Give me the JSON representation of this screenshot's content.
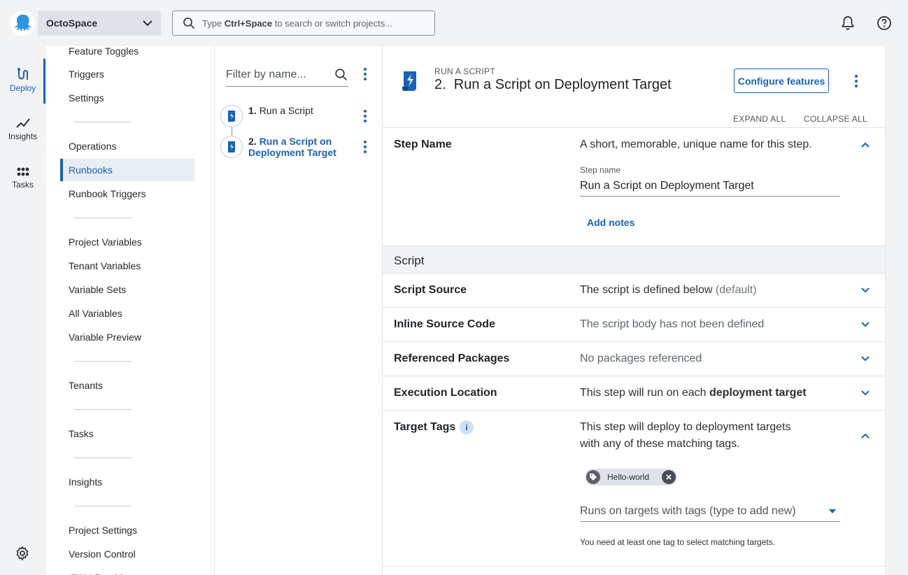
{
  "app": {
    "space_name": "OctoSpace",
    "search_placeholder_prefix": "Type ",
    "search_placeholder_key": "Ctrl+Space",
    "search_placeholder_suffix": " to search or switch projects...",
    "accent": "#1a62b4"
  },
  "rail": {
    "items": [
      {
        "label": "Deploy",
        "icon": "deploy-icon",
        "active": true
      },
      {
        "label": "Insights",
        "icon": "insights-icon"
      },
      {
        "label": "Tasks",
        "icon": "tasks-icon"
      }
    ]
  },
  "nav": {
    "items": [
      "Feature Toggles",
      "Triggers",
      "Settings",
      "Operations",
      "Runbooks",
      "Runbook Triggers",
      "Project Variables",
      "Tenant Variables",
      "Variable Sets",
      "All Variables",
      "Variable Preview",
      "Tenants",
      "Tasks",
      "Insights",
      "Project Settings",
      "Version Control",
      "ITSM Providers"
    ],
    "active": "Runbooks"
  },
  "steps": {
    "filter_placeholder": "Filter by name...",
    "items": [
      {
        "number": "1.",
        "name": "Run a Script"
      },
      {
        "number": "2.",
        "name": "Run a Script on Deployment Target",
        "active": true
      }
    ]
  },
  "main": {
    "breadcrumb": "RUN A SCRIPT",
    "title": "2.  Run a Script on Deployment Target",
    "configure_button": "Configure features",
    "expand_all": "EXPAND ALL",
    "collapse_all": "COLLAPSE ALL",
    "step_name": {
      "label": "Step Name",
      "summary": "A short, memorable, unique name for this step.",
      "field_label": "Step name",
      "field_value": "Run a Script on Deployment Target",
      "add_notes": "Add notes"
    },
    "group_title": "Script",
    "script_source": {
      "label": "Script Source",
      "summary": "The script is defined below",
      "suffix": "(default)"
    },
    "inline_source": {
      "label": "Inline Source Code",
      "summary": "The script body has not been defined"
    },
    "packages": {
      "label": "Referenced Packages",
      "summary": "No packages referenced"
    },
    "execution": {
      "label": "Execution Location",
      "summary_prefix": "This step will run on each ",
      "summary_bold": "deployment target"
    },
    "target_tags": {
      "label": "Target Tags",
      "info": "i",
      "summary_line1": "This step will deploy to deployment targets",
      "summary_line2": "with any of these matching tags.",
      "chip": "Hello-world",
      "input_placeholder": "Runs on targets with tags (type to add new)",
      "help": "You need at least one tag to select matching targets."
    }
  }
}
